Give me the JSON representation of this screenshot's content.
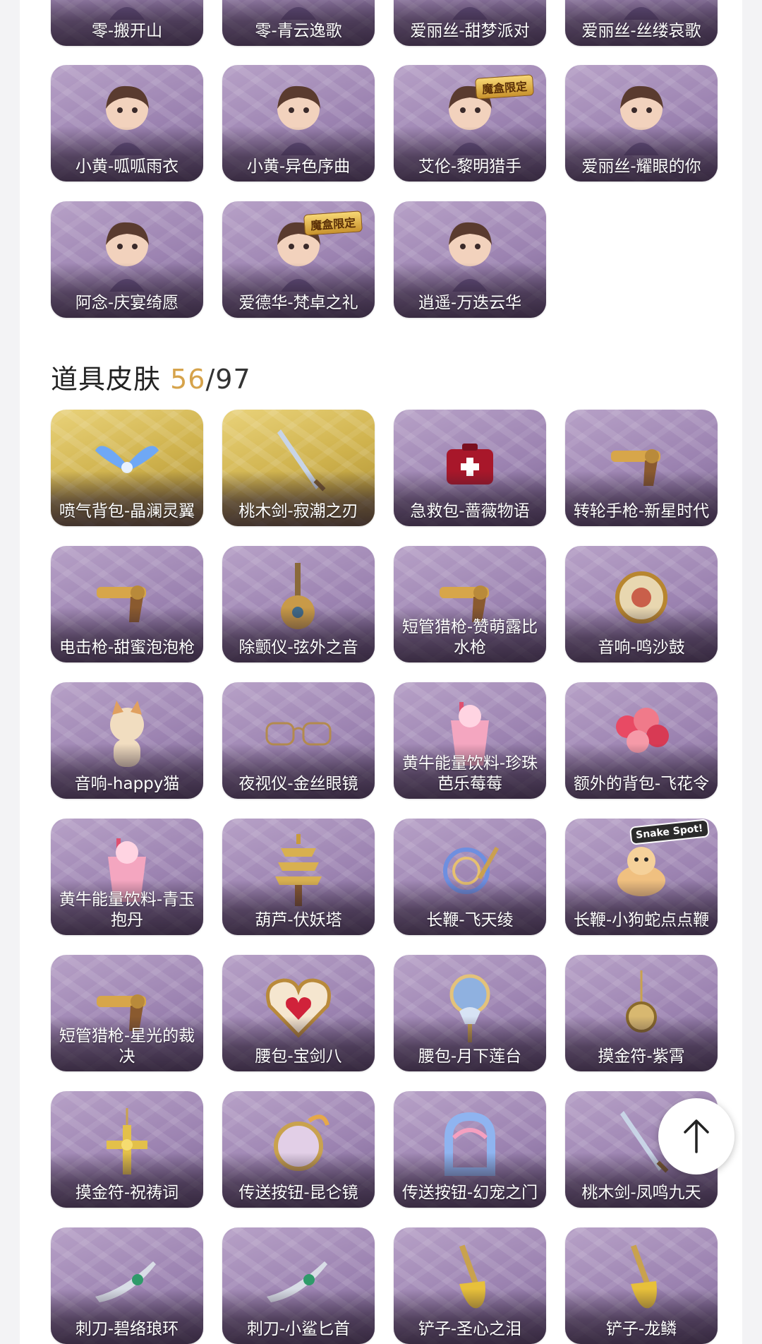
{
  "character_skins": [
    {
      "label": "零-搬开山",
      "art": "portrait"
    },
    {
      "label": "零-青云逸歌",
      "art": "portrait"
    },
    {
      "label": "爱丽丝-甜梦派对",
      "art": "portrait"
    },
    {
      "label": "爱丽丝-丝缕哀歌",
      "art": "portrait"
    },
    {
      "label": "小黄-呱呱雨衣",
      "art": "portrait"
    },
    {
      "label": "小黄-异色序曲",
      "art": "portrait"
    },
    {
      "label": "艾伦-黎明猎手",
      "art": "portrait",
      "badge": "魔盒限定"
    },
    {
      "label": "爱丽丝-耀眼的你",
      "art": "portrait"
    },
    {
      "label": "阿念-庆宴绮愿",
      "art": "portrait"
    },
    {
      "label": "爱德华-梵卓之礼",
      "art": "portrait",
      "badge": "魔盒限定"
    },
    {
      "label": "逍遥-万迭云华",
      "art": "portrait"
    }
  ],
  "item_section": {
    "title": "道具皮肤",
    "owned": "56",
    "total": "/97"
  },
  "item_skins": [
    {
      "label": "喷气背包-晶澜灵翼",
      "art": "wings",
      "tier": "gold"
    },
    {
      "label": "桃木剑-寂潮之刃",
      "art": "sword",
      "tier": "gold"
    },
    {
      "label": "急救包-蔷薇物语",
      "art": "medkit"
    },
    {
      "label": "转轮手枪-新星时代",
      "art": "gun"
    },
    {
      "label": "电击枪-甜蜜泡泡枪",
      "art": "gun"
    },
    {
      "label": "除颤仪-弦外之音",
      "art": "lute"
    },
    {
      "label": "短管猎枪-赞萌露比水枪",
      "art": "gun"
    },
    {
      "label": "音响-鸣沙鼓",
      "art": "drum"
    },
    {
      "label": "音响-happy猫",
      "art": "cat"
    },
    {
      "label": "夜视仪-金丝眼镜",
      "art": "glasses"
    },
    {
      "label": "黄牛能量饮料-珍珠芭乐莓莓",
      "art": "drink"
    },
    {
      "label": "额外的背包-飞花令",
      "art": "flowers"
    },
    {
      "label": "黄牛能量饮料-青玉抱丹",
      "art": "drink"
    },
    {
      "label": "葫芦-伏妖塔",
      "art": "pagoda"
    },
    {
      "label": "长鞭-飞天绫",
      "art": "whip"
    },
    {
      "label": "长鞭-小狗蛇点点鞭",
      "art": "snake",
      "badge2": "Snake Spot!"
    },
    {
      "label": "短管猎枪-星光的裁决",
      "art": "gun"
    },
    {
      "label": "腰包-宝剑八",
      "art": "heart"
    },
    {
      "label": "腰包-月下莲台",
      "art": "lotus"
    },
    {
      "label": "摸金符-紫霄",
      "art": "charm"
    },
    {
      "label": "摸金符-祝祷词",
      "art": "cross"
    },
    {
      "label": "传送按钮-昆仑镜",
      "art": "mirror"
    },
    {
      "label": "传送按钮-幻宠之门",
      "art": "portal"
    },
    {
      "label": "桃木剑-凤鸣九天",
      "art": "sword"
    },
    {
      "label": "刺刀-碧络琅环",
      "art": "dagger"
    },
    {
      "label": "刺刀-小鲨匕首",
      "art": "dagger"
    },
    {
      "label": "铲子-圣心之泪",
      "art": "shovel"
    },
    {
      "label": "铲子-龙鳞",
      "art": "shovel"
    }
  ],
  "scroll_top_button": {
    "icon": "arrow-up-icon"
  }
}
